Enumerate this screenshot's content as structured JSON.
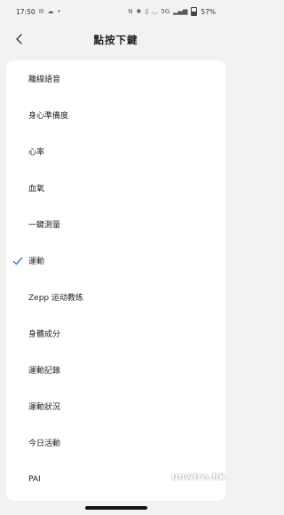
{
  "status_bar": {
    "time": "17:50",
    "left_icons": [
      "message-icon",
      "cloud-icon",
      "dot-icon"
    ],
    "right_icons": [
      "nfc-icon",
      "bluetooth-icon",
      "vibrate-icon",
      "wifi-icon",
      "signal-icon"
    ],
    "network": "5G",
    "battery": "57%"
  },
  "header": {
    "title": "點按下鍵"
  },
  "options": [
    {
      "label": "離線語音",
      "selected": false
    },
    {
      "label": "身心準備度",
      "selected": false
    },
    {
      "label": "心率",
      "selected": false
    },
    {
      "label": "血氧",
      "selected": false
    },
    {
      "label": "一鍵測量",
      "selected": false
    },
    {
      "label": "運動",
      "selected": true
    },
    {
      "label": "Zepp 运动教练",
      "selected": false
    },
    {
      "label": "身體成分",
      "selected": false
    },
    {
      "label": "運動記錄",
      "selected": false
    },
    {
      "label": "運動狀況",
      "selected": false
    },
    {
      "label": "今日活動",
      "selected": false
    },
    {
      "label": "PAI",
      "selected": false
    }
  ],
  "watermark": "unwire.hk",
  "colors": {
    "accent": "#2f7be5",
    "background": "#f2f2f2",
    "card": "#ffffff"
  }
}
